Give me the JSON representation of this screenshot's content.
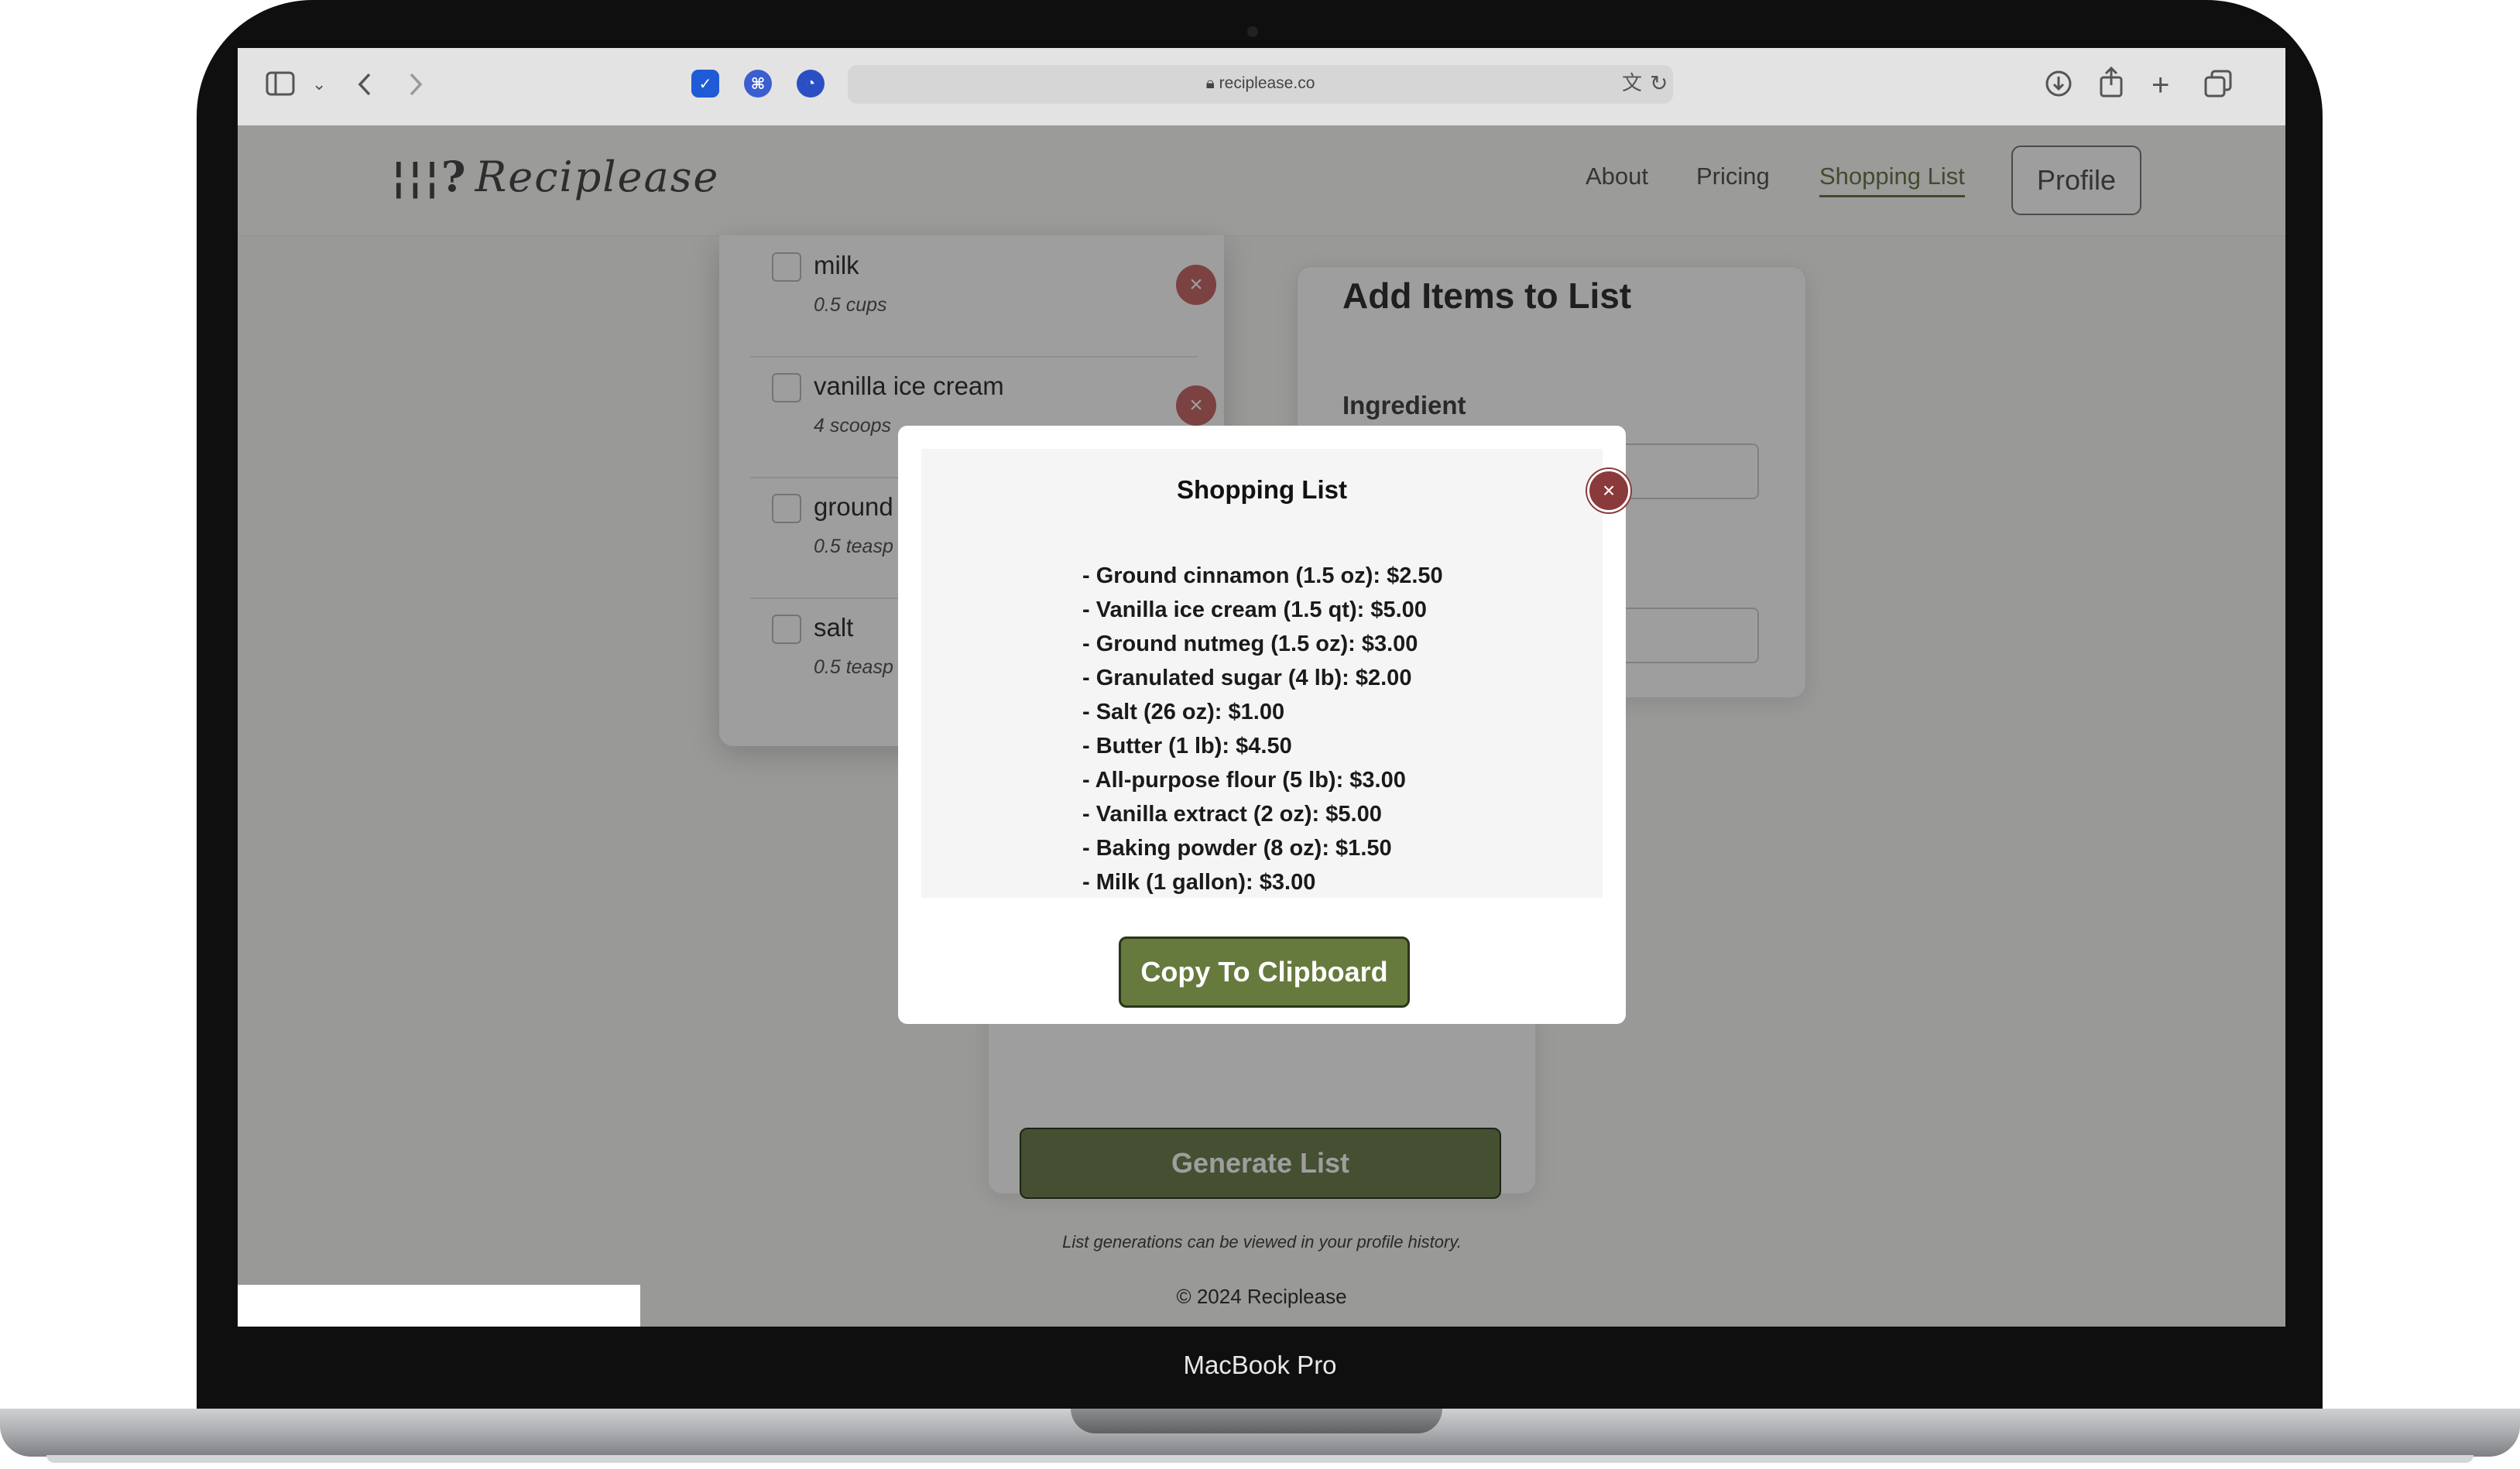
{
  "device": {
    "model_label": "MacBook Pro"
  },
  "browser": {
    "url": "reciplease.co",
    "lock_icon": "lock-icon",
    "extensions": [
      "bitwarden-shield-icon",
      "command-icon",
      "clock-icon"
    ]
  },
  "site": {
    "logo_glyph": "¦¦¦?",
    "logo_text": "Reciplease",
    "nav": {
      "about": "About",
      "pricing": "Pricing",
      "shopping_list": "Shopping List",
      "profile": "Profile"
    }
  },
  "list_items": [
    {
      "name": "milk",
      "qty": "0.5 cups"
    },
    {
      "name": "vanilla ice cream",
      "qty": "4 scoops"
    },
    {
      "name": "ground",
      "qty": "0.5 teasp"
    },
    {
      "name": "salt",
      "qty": "0.5 teasp"
    }
  ],
  "add_form": {
    "title": "Add Items to List",
    "ingredient_label": "Ingredient"
  },
  "generate": {
    "button": "Generate List",
    "note": "List generations can be viewed in your profile history."
  },
  "footer": "© 2024 Reciplease",
  "modal": {
    "title": "Shopping List",
    "items": [
      "- Ground cinnamon (1.5 oz): $2.50",
      "- Vanilla ice cream (1.5 qt): $5.00",
      "- Ground nutmeg (1.5 oz): $3.00",
      "- Granulated sugar (4 lb): $2.00",
      "- Salt (26 oz): $1.00",
      "- Butter (1 lb): $4.50",
      "- All-purpose flour (5 lb): $3.00",
      "- Vanilla extract (2 oz): $5.00",
      "- Baking powder (8 oz): $1.50",
      "- Milk (1 gallon): $3.00"
    ],
    "copy_button": "Copy To Clipboard",
    "close_symbol": "×"
  },
  "colors": {
    "accent_green": "#667a3d",
    "close_red": "#8a3a3a"
  }
}
